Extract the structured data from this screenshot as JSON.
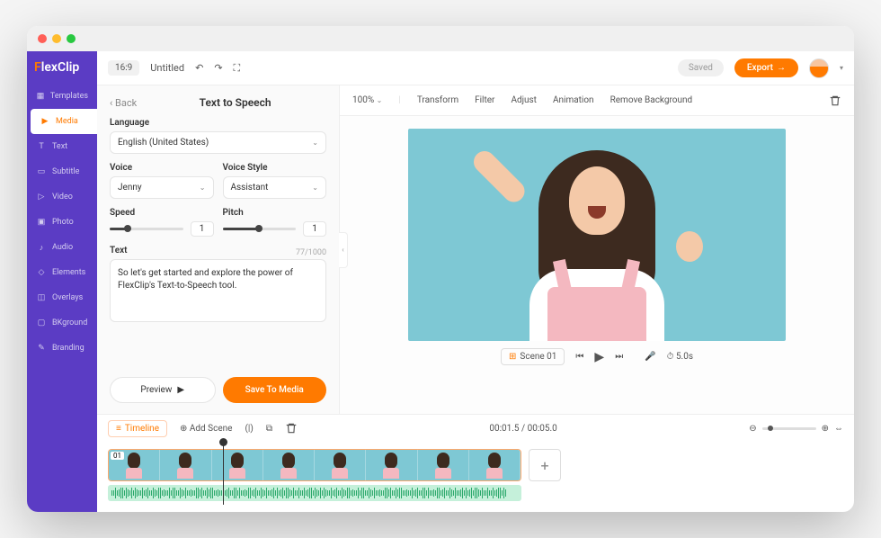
{
  "brand": "FlexClip",
  "sidebar": {
    "items": [
      {
        "label": "Templates"
      },
      {
        "label": "Media"
      },
      {
        "label": "Text"
      },
      {
        "label": "Subtitle"
      },
      {
        "label": "Video"
      },
      {
        "label": "Photo"
      },
      {
        "label": "Audio"
      },
      {
        "label": "Elements"
      },
      {
        "label": "Overlays"
      },
      {
        "label": "BKground"
      },
      {
        "label": "Branding"
      }
    ]
  },
  "topbar": {
    "ratio": "16:9",
    "project": "Untitled",
    "saved": "Saved",
    "export": "Export"
  },
  "panel": {
    "back": "Back",
    "title": "Text to Speech",
    "language_label": "Language",
    "language_value": "English (United States)",
    "voice_label": "Voice",
    "voice_value": "Jenny",
    "style_label": "Voice Style",
    "style_value": "Assistant",
    "speed_label": "Speed",
    "speed_value": "1",
    "pitch_label": "Pitch",
    "pitch_value": "1",
    "text_label": "Text",
    "text_counter": "77/1000",
    "text_value": "So let's get started and explore the power of FlexClip's Text-to-Speech tool.",
    "preview": "Preview",
    "save": "Save To Media"
  },
  "canvas": {
    "zoom": "100%",
    "tools": [
      "Transform",
      "Filter",
      "Adjust",
      "Animation",
      "Remove Background"
    ],
    "scene": "Scene 01",
    "duration": "5.0s"
  },
  "timeline": {
    "tab": "Timeline",
    "add": "Add Scene",
    "pos": "00:01.5 / 00:05.0",
    "clip_num": "01"
  }
}
